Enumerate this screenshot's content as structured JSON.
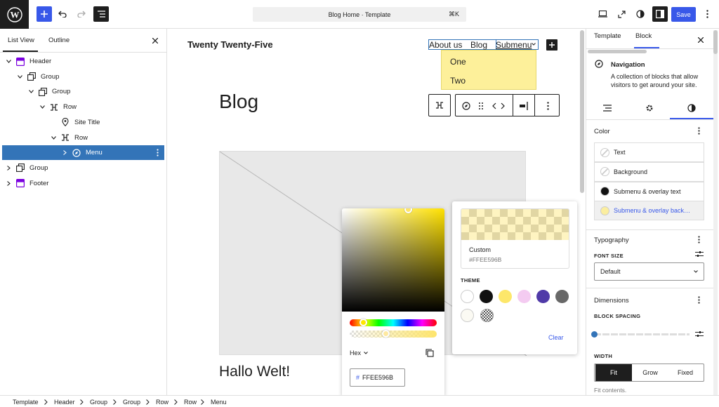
{
  "header": {
    "command_bar": "Blog Home · Template",
    "shortcut": "⌘K",
    "save": "Save"
  },
  "left_panel": {
    "tabs": [
      "List View",
      "Outline"
    ],
    "tree": [
      {
        "label": "Header",
        "icon": "template-part-icon",
        "depth": 0,
        "chevron": "down"
      },
      {
        "label": "Group",
        "icon": "group-icon",
        "depth": 1,
        "chevron": "down"
      },
      {
        "label": "Group",
        "icon": "group-icon",
        "depth": 2,
        "chevron": "down"
      },
      {
        "label": "Row",
        "icon": "row-icon",
        "depth": 3,
        "chevron": "down"
      },
      {
        "label": "Site Title",
        "icon": "map-marker-icon",
        "depth": 4,
        "chevron": ""
      },
      {
        "label": "Row",
        "icon": "row-icon",
        "depth": 4,
        "chevron": "down"
      },
      {
        "label": "Menu",
        "icon": "navigation-icon",
        "depth": 5,
        "chevron": "right",
        "selected": true
      },
      {
        "label": "Group",
        "icon": "group-icon",
        "depth": 0,
        "chevron": "right"
      },
      {
        "label": "Footer",
        "icon": "template-part-icon",
        "depth": 0,
        "chevron": "right"
      }
    ]
  },
  "canvas": {
    "site_title": "Twenty Twenty-Five",
    "nav": [
      "About us",
      "Blog",
      "Submenu"
    ],
    "submenu_items": [
      "One",
      "Two"
    ],
    "page_title": "Blog",
    "post_title": "Hallo Welt!"
  },
  "color_picker": {
    "format": "Hex",
    "hex_value": "FFEE596B",
    "hex_prefix": "#"
  },
  "palette": {
    "custom_label": "Custom",
    "custom_value": "#FFEE596B",
    "theme_label": "THEME",
    "clear": "Clear",
    "theme_colors": [
      "#ffffff",
      "#111111",
      "#fde76a",
      "#f4cbf1",
      "#503aa8",
      "#686868",
      "#fbfaf3"
    ]
  },
  "right_panel": {
    "tabs": [
      "Template",
      "Block"
    ],
    "block_name": "Navigation",
    "block_description": "A collection of blocks that allow visitors to get around your site.",
    "color_title": "Color",
    "color_items": [
      {
        "label": "Text",
        "swatch": "none"
      },
      {
        "label": "Background",
        "swatch": "none"
      },
      {
        "label": "Submenu & overlay text",
        "swatch": "#111111"
      },
      {
        "label": "Submenu & overlay back…",
        "swatch": "#fbeea0",
        "active": true
      }
    ],
    "typography_title": "Typography",
    "font_size_label": "FONT SIZE",
    "font_size_value": "Default",
    "dimensions_title": "Dimensions",
    "block_spacing_label": "BLOCK SPACING",
    "width_label": "WIDTH",
    "width_options": [
      "Fit",
      "Grow",
      "Fixed"
    ],
    "width_selected": "Fit",
    "width_help": "Fit contents."
  },
  "breadcrumb": [
    "Template",
    "Header",
    "Group",
    "Group",
    "Row",
    "Row",
    "Menu"
  ],
  "colors": {
    "accent": "#3858e9",
    "selection": "#3374b8",
    "submenu_bg": "#fdf09a"
  }
}
